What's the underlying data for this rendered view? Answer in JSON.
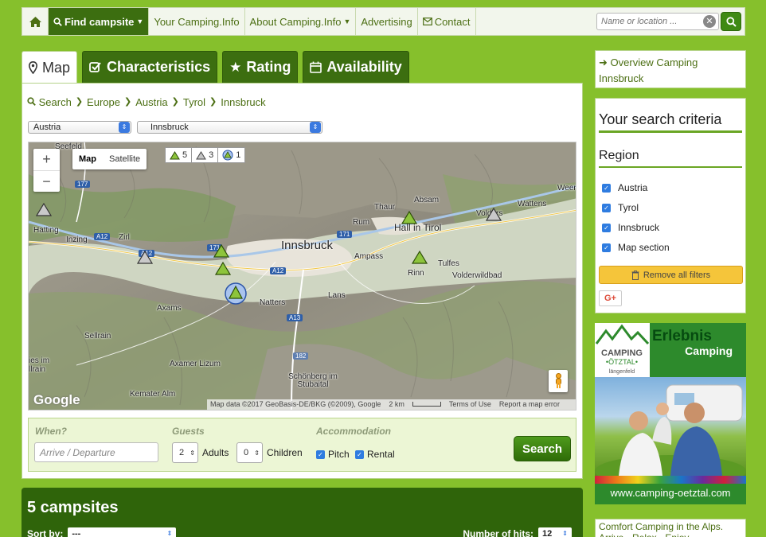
{
  "nav": {
    "items": [
      {
        "label": "Find campsite",
        "dropdown": true,
        "active": true
      },
      {
        "label": "Your Camping.Info"
      },
      {
        "label": "About Camping.Info",
        "dropdown": true
      },
      {
        "label": "Advertising"
      },
      {
        "label": "Contact"
      }
    ],
    "search_placeholder": "Name or location ..."
  },
  "tabs": [
    "Map",
    "Characteristics",
    "Rating",
    "Availability"
  ],
  "breadcrumb": [
    "Search",
    "Europe",
    "Austria",
    "Tyrol",
    "Innsbruck"
  ],
  "selects": {
    "country": "Austria",
    "city": "Innsbruck"
  },
  "map": {
    "zoom_in": "+",
    "zoom_out": "−",
    "type_map": "Map",
    "type_satellite": "Satellite",
    "legend": [
      {
        "icon": "green-tent",
        "count": "5"
      },
      {
        "icon": "grey-tent",
        "count": "3"
      },
      {
        "icon": "blue-tent",
        "count": "1"
      }
    ],
    "places": {
      "seefeld": "Seefeld",
      "hatting": "Hatting",
      "inzing": "Inzing",
      "zirl": "Zirl",
      "innsbruck": "Innsbruck",
      "thaur": "Thaur",
      "absam": "Absam",
      "rum": "Rum",
      "hall": "Hall in Tirol",
      "wattens": "Wattens",
      "volders": "Volders",
      "weer": "Weer",
      "ampass": "Ampass",
      "tulfes": "Tulfes",
      "rinn": "Rinn",
      "volderwildbad": "Volderwildbad",
      "lans": "Lans",
      "natters": "Natters",
      "axams": "Axams",
      "sellrain": "Sellrain",
      "axamer_lizum": "Axamer Lizum",
      "schonberg": "Schönberg im Stubaital",
      "kemater_alm": "Kemater Alm",
      "gries": "ies im llrain"
    },
    "roads": {
      "r177a": "177",
      "a12a": "A12",
      "a12b": "A12",
      "r171a": "171",
      "r171b": "171",
      "a12c": "A12",
      "a13": "A13",
      "r182": "182"
    },
    "attribution": {
      "data": "Map data ©2017 GeoBasis-DE/BKG (©2009), Google",
      "scale": "2 km",
      "terms": "Terms of Use",
      "report": "Report a map error"
    },
    "logo": "Google"
  },
  "booking": {
    "when_label": "When?",
    "date_placeholder": "Arrive / Departure",
    "guests_label": "Guests",
    "adults_value": "2",
    "adults_label": "Adults",
    "children_value": "0",
    "children_label": "Children",
    "accommodation_label": "Accommodation",
    "pitch_label": "Pitch",
    "rental_label": "Rental",
    "search_label": "Search"
  },
  "results": {
    "title": "5 campsites",
    "sort_label": "Sort by:",
    "sort_value": "---",
    "hits_label": "Number of hits:",
    "hits_value": "12"
  },
  "sidebar": {
    "overview_link": "Overview Camping Innsbruck",
    "criteria_title": "Your search criteria",
    "region_title": "Region",
    "regions": [
      "Austria",
      "Tyrol",
      "Innsbruck",
      "Map section"
    ],
    "remove_label": "Remove all filters",
    "gplus_label": "G+",
    "promo_text": "Comfort Camping in the Alps. Arrive - Relax - Enjoy"
  },
  "ad": {
    "headline": "Erlebnis",
    "subline": "Camping",
    "logo_line1": "CAMPING",
    "logo_line2": "•ÖTZTAL•",
    "logo_line3": "längenfeld",
    "url": "www.camping-oetztal.com"
  }
}
